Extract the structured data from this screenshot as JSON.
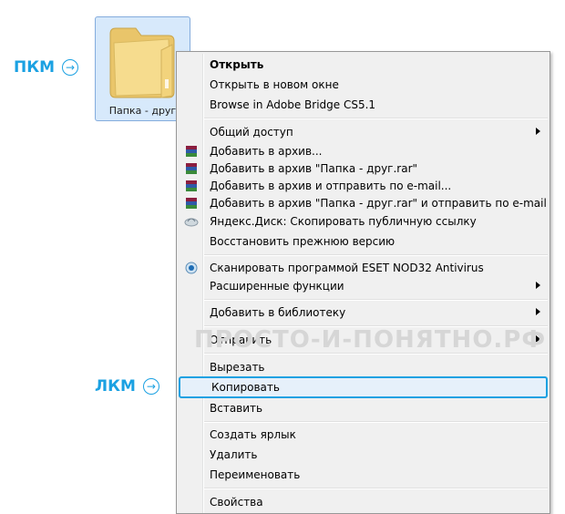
{
  "folder": {
    "label": "Папка - друг"
  },
  "annotations": {
    "right_click": "ПКМ",
    "left_click": "ЛКМ"
  },
  "watermark": "ПРОСТО-И-ПОНЯТНО.РФ",
  "menu": {
    "items": [
      {
        "label": "Открыть"
      },
      {
        "label": "Открыть в новом окне"
      },
      {
        "label": "Browse in Adobe Bridge CS5.1"
      },
      {
        "label": "Общий доступ"
      },
      {
        "label": "Добавить в архив..."
      },
      {
        "label": "Добавить в архив \"Папка - друг.rar\""
      },
      {
        "label": "Добавить в архив и отправить по e-mail..."
      },
      {
        "label": "Добавить в архив \"Папка - друг.rar\" и отправить по e-mail"
      },
      {
        "label": "Яндекс.Диск: Скопировать публичную ссылку"
      },
      {
        "label": "Восстановить прежнюю версию"
      },
      {
        "label": "Сканировать программой ESET NOD32 Antivirus"
      },
      {
        "label": "Расширенные функции"
      },
      {
        "label": "Добавить в библиотеку"
      },
      {
        "label": "Отправить"
      },
      {
        "label": "Вырезать"
      },
      {
        "label": "Копировать"
      },
      {
        "label": "Вставить"
      },
      {
        "label": "Создать ярлык"
      },
      {
        "label": "Удалить"
      },
      {
        "label": "Переименовать"
      },
      {
        "label": "Свойства"
      }
    ]
  },
  "colors": {
    "accent": "#1ba1e2",
    "menu_bg": "#f0f0f0",
    "selection_bg": "#e6f0fa"
  }
}
